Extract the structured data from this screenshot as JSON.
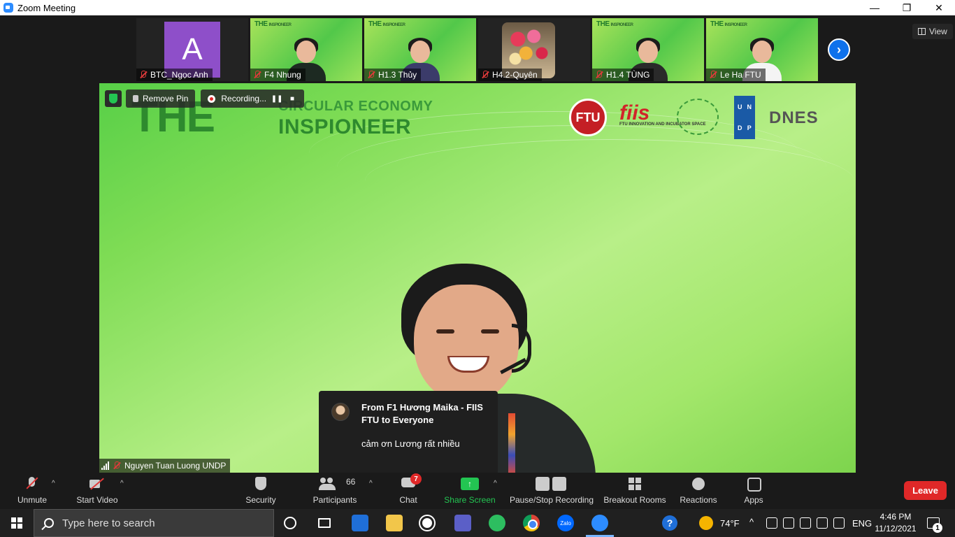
{
  "window": {
    "title": "Zoom Meeting",
    "controls": {
      "minimize": "—",
      "maximize": "❐",
      "close": "✕"
    }
  },
  "view_button": {
    "label": "View"
  },
  "participants_strip": [
    {
      "name": "BTC_Ngọc Anh",
      "avatar_letter": "A",
      "muted": true,
      "avatar_color": "#8e4fc9"
    },
    {
      "name": "F4 Nhung",
      "muted": true
    },
    {
      "name": "H1.3 Thủy",
      "muted": true
    },
    {
      "name": "H4.2-Quyên",
      "muted": true
    },
    {
      "name": "H1.4 TÙNG",
      "muted": true
    },
    {
      "name": "Le Ha FTU",
      "muted": true
    }
  ],
  "mini_banner": {
    "the": "THE",
    "sub": "INSPIONEER"
  },
  "main_video": {
    "banner": {
      "the": "THE",
      "line1": "CIRCULAR ECONOMY",
      "line2": "INSPIONEER"
    },
    "logos": {
      "ftu": "FTU",
      "fiis": "fiis",
      "fiis_sub": "FTU INNOVATION AND INCUBATOR SPACE",
      "undp": [
        "U",
        "N",
        "D",
        "P"
      ],
      "dnes": "DNES"
    },
    "speaker_name": "Nguyen Tuan Luong UNDP",
    "remove_pin_label": "Remove Pin",
    "recording_label": "Recording..."
  },
  "chat_toast": {
    "from": "From F1 Hương Maika - FIIS FTU to Everyone",
    "message": "cảm ơn Lương rất nhiều"
  },
  "toolbar": {
    "unmute": "Unmute",
    "start_video": "Start Video",
    "security": "Security",
    "participants": "Participants",
    "participants_count": "66",
    "chat": "Chat",
    "chat_badge": "7",
    "share_screen": "Share Screen",
    "pause_recording": "Pause/Stop Recording",
    "breakout_rooms": "Breakout Rooms",
    "reactions": "Reactions",
    "apps": "Apps",
    "leave": "Leave",
    "share_color": "#23c552",
    "leave_color": "#e02828"
  },
  "taskbar": {
    "search_placeholder": "Type here to search",
    "zalo_label": "Zalo",
    "weather": "74°F",
    "language": "ENG",
    "time": "4:46 PM",
    "date": "11/12/2021",
    "notification_count": "1"
  }
}
